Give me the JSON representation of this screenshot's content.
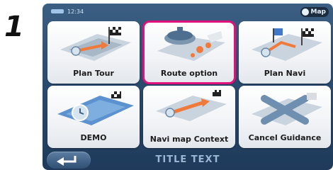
{
  "step_number": "1",
  "status": {
    "time": "12:34",
    "map_button": "Map"
  },
  "tiles": [
    {
      "label": "Plan Tour"
    },
    {
      "label": "Route option"
    },
    {
      "label": "Plan Navi"
    },
    {
      "label": "DEMO"
    },
    {
      "label": "Navi map Context"
    },
    {
      "label": "Cancel Guidance"
    }
  ],
  "bottom": {
    "title": "TITLE TEXT"
  },
  "colors": {
    "highlight": "#e0117a",
    "background": "#2a4a6e"
  }
}
